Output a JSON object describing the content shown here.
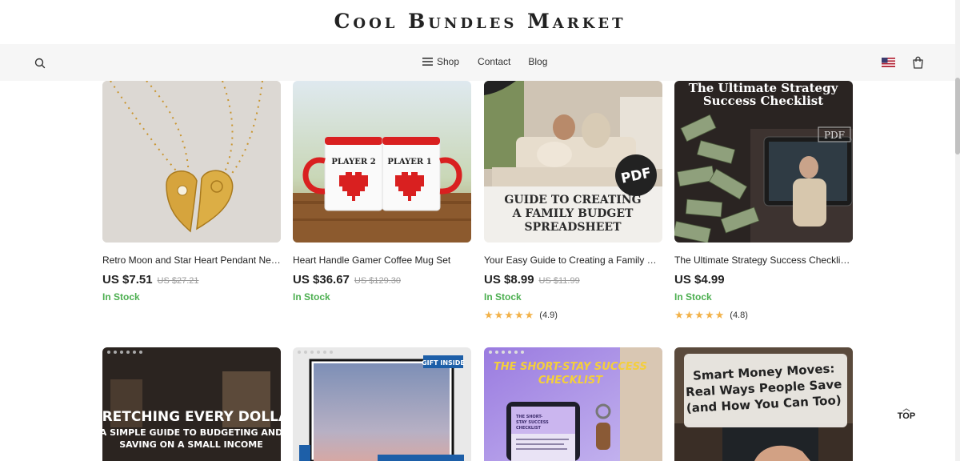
{
  "brand": {
    "title": "Cool Bundles Market"
  },
  "nav": {
    "shop": "Shop",
    "contact": "Contact",
    "blog": "Blog",
    "icons": {
      "search": "search-icon",
      "menu": "menu-icon",
      "flag": "us-flag-icon",
      "cart": "shopping-bag-icon"
    }
  },
  "products": [
    {
      "title": "Retro Moon and Star Heart Pendant Necklace",
      "price": "US $7.51",
      "compare_price": "US $27.21",
      "stock": "In Stock",
      "rating": null
    },
    {
      "title": "Heart Handle Gamer Coffee Mug Set",
      "price": "US $36.67",
      "compare_price": "US $129.30",
      "stock": "In Stock",
      "rating": null
    },
    {
      "title": "Your Easy Guide to Creating a Family Budget Spreadsheet",
      "price": "US $8.99",
      "compare_price": "US $11.99",
      "stock": "In Stock",
      "rating": "(4.9)"
    },
    {
      "title": "The Ultimate Strategy Success Checklist: PDF",
      "price": "US $4.99",
      "compare_price": "",
      "stock": "In Stock",
      "rating": "(4.8)"
    }
  ],
  "images": {
    "mug_labels": [
      "PLAYER 2",
      "PLAYER 1"
    ],
    "budget_pdf_badge": "PDF",
    "budget_title": [
      "GUIDE TO CREATING",
      "A FAMILY BUDGET",
      "SPREADSHEET"
    ],
    "checklist_title": [
      "The Ultimate Strategy",
      "Success Checklist"
    ],
    "checklist_pdf": "PDF",
    "dollar_title": "STRETCHING EVERY DOLLAR",
    "dollar_sub": [
      "A SIMPLE GUIDE TO BUDGETING AND",
      "SAVING ON A SMALL INCOME"
    ],
    "gift_badge": "GIFT INSIDE",
    "shortstay_title": [
      "THE SHORT-STAY SUCCESS",
      "CHECKLIST"
    ],
    "shortstay_screen": [
      "THE SHORT-",
      "STAY SUCCESS",
      "CHECKLIST"
    ],
    "money_title": [
      "Smart Money Moves:",
      "Real Ways People Save",
      "(and How You Can Too)"
    ]
  },
  "top_button": "TOP",
  "colors": {
    "accent_green": "#4caf50",
    "star": "#f2b24a",
    "nav_bg": "#f6f6f6"
  }
}
